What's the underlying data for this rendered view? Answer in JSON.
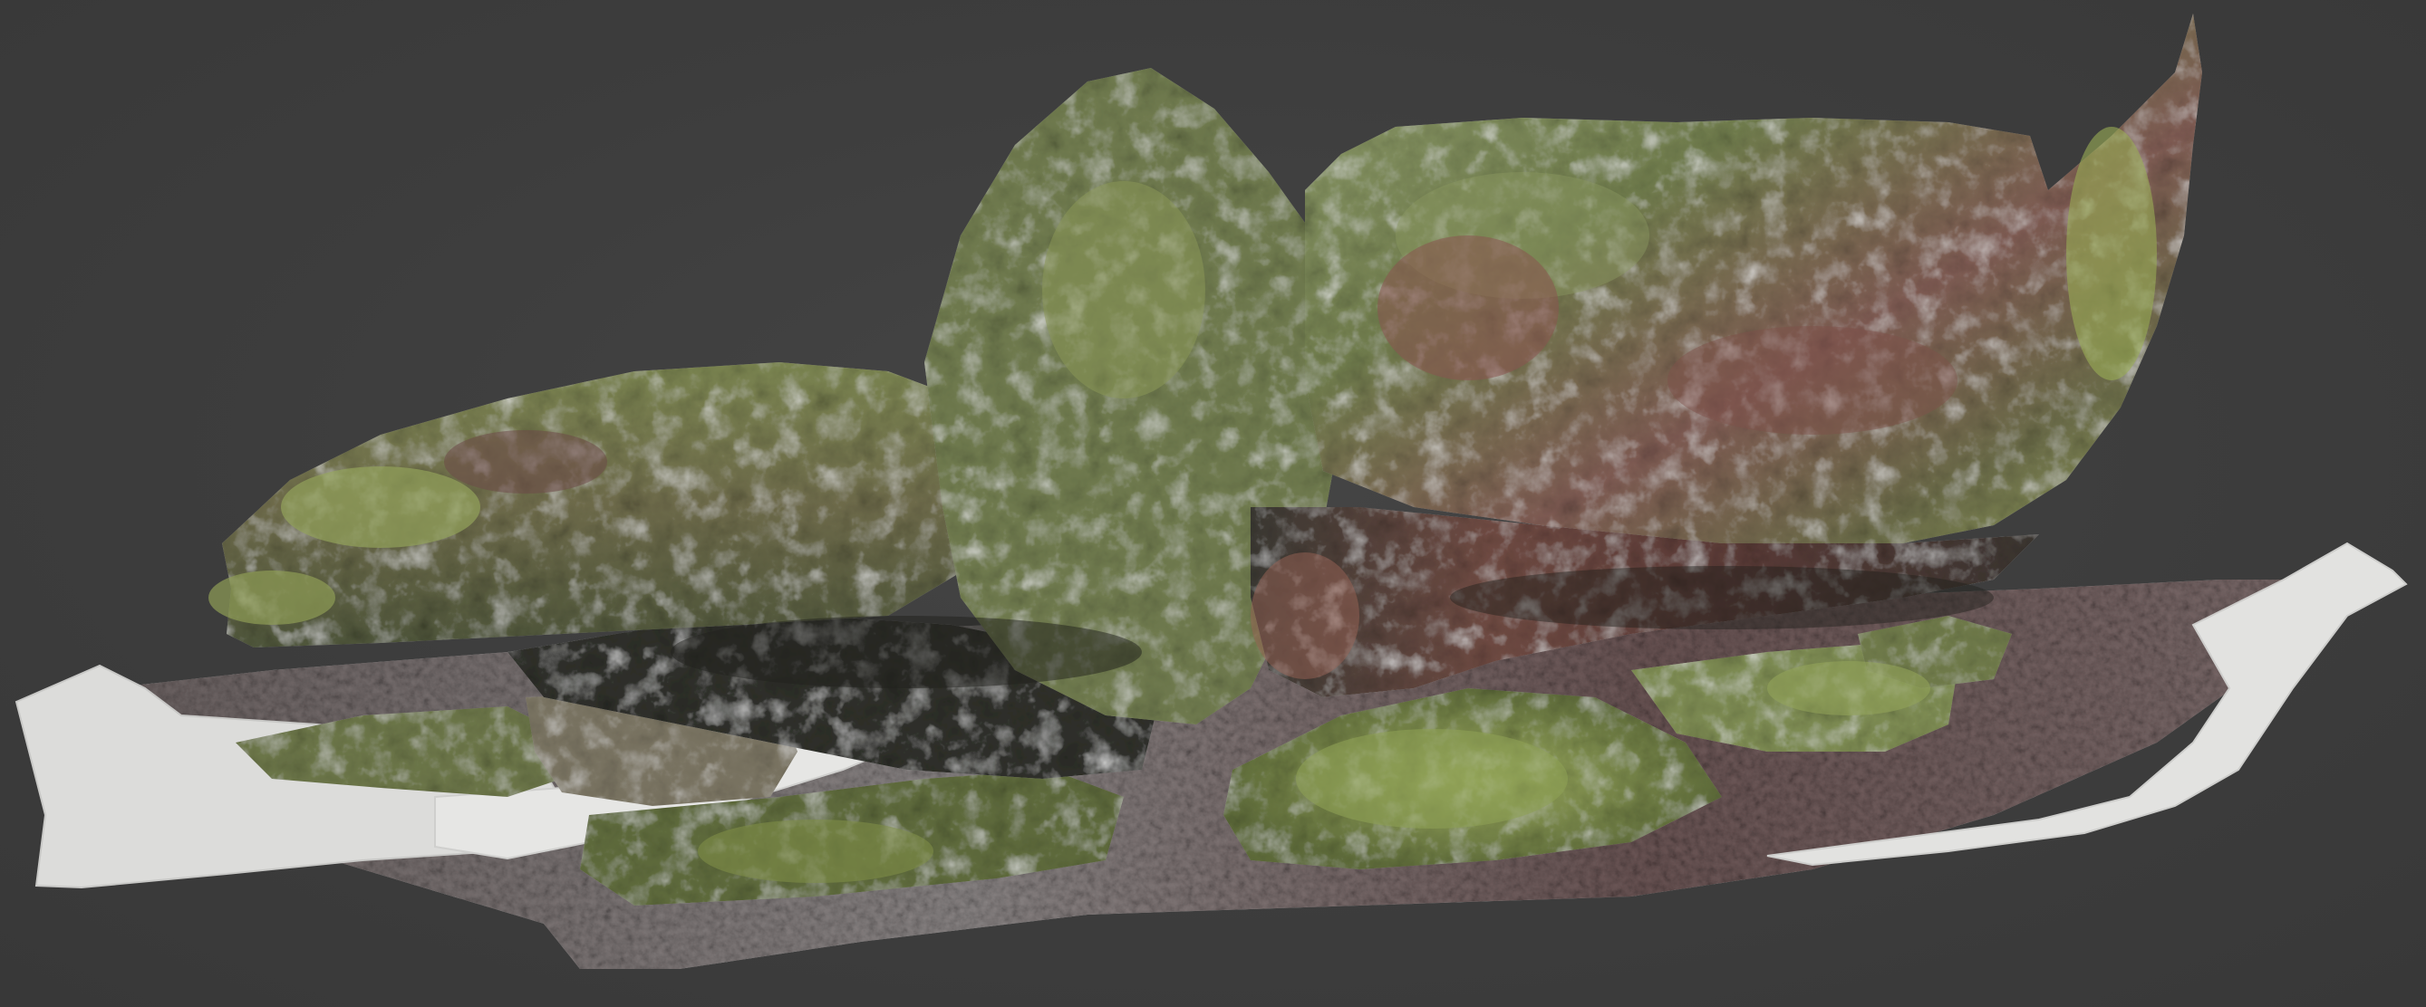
{
  "viewport": {
    "background_color": "#3d3d3d"
  },
  "model": {
    "subject": "photogrammetry-rock-overhang",
    "colors": {
      "moss_light": "#8a9a5a",
      "moss_dark": "#5d6b3c",
      "rock_red": "#7a4a44",
      "rock_shadow": "#2c2a26",
      "ground_leaf": "#6e5a55",
      "mesh_edge": "#d8d8d6"
    }
  }
}
